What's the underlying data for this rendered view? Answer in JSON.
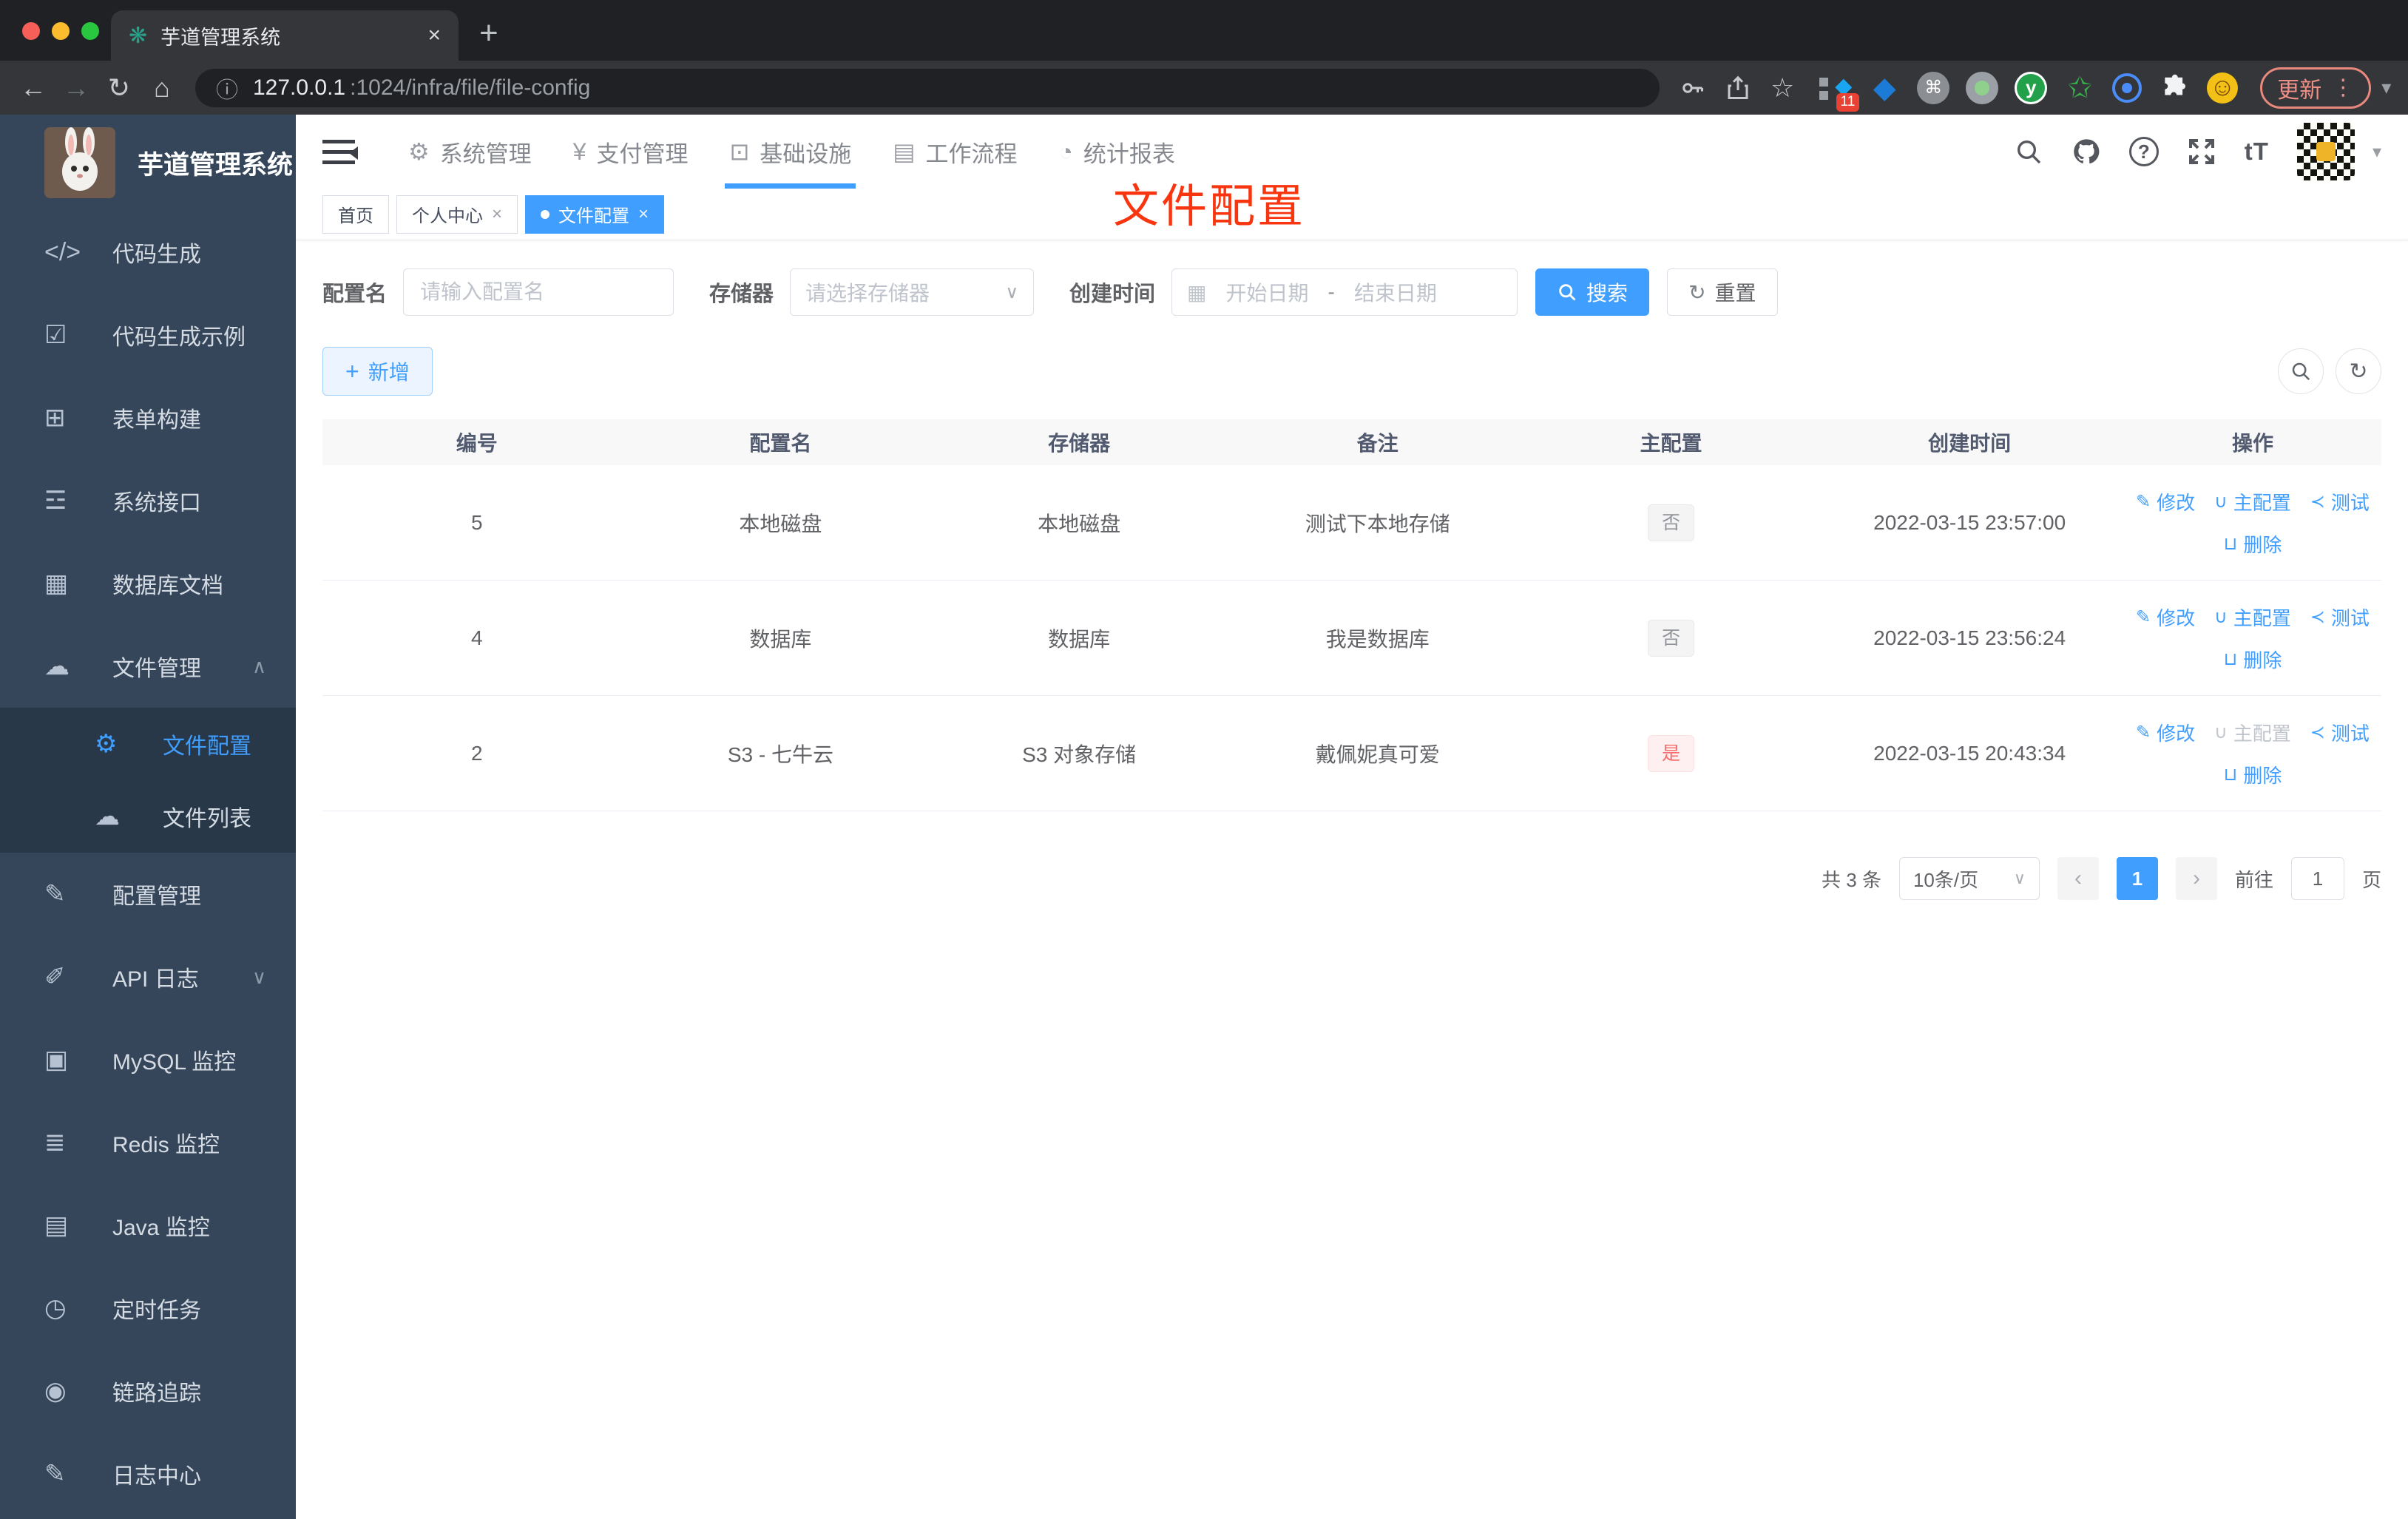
{
  "browser": {
    "tab": {
      "favicon": "❋",
      "title": "芋道管理系统",
      "close": "×",
      "new_tab": "+"
    },
    "nav": {
      "back": "←",
      "forward": "→",
      "reload": "↻",
      "home": "⌂"
    },
    "url": {
      "info": "ⓘ",
      "host": "127.0.0.1",
      "path": ":1024/infra/file/file-config"
    },
    "star": "☆",
    "extensions": {
      "badge": "11",
      "diamond": "◆",
      "kite": "◆",
      "cmd": "⌘",
      "y": "y",
      "star": "✩",
      "smile": "☺"
    },
    "update": {
      "label": "更新",
      "dots": "⋮",
      "caret": "▾"
    }
  },
  "sidebar": {
    "title": "芋道管理系统",
    "items": [
      {
        "icon": "</>",
        "label": "代码生成"
      },
      {
        "icon": "☑",
        "label": "代码生成示例"
      },
      {
        "icon": "⊞",
        "label": "表单构建"
      },
      {
        "icon": "☲",
        "label": "系统接口"
      },
      {
        "icon": "▦",
        "label": "数据库文档"
      },
      {
        "icon": "☁",
        "label": "文件管理",
        "arrow": "∧"
      },
      {
        "icon": "⚙",
        "label": "文件配置"
      },
      {
        "icon": "☁",
        "label": "文件列表"
      },
      {
        "icon": "✎",
        "label": "配置管理"
      },
      {
        "icon": "✐",
        "label": "API 日志",
        "arrow": "∨"
      },
      {
        "icon": "▣",
        "label": "MySQL 监控"
      },
      {
        "icon": "≣",
        "label": "Redis 监控"
      },
      {
        "icon": "▤",
        "label": "Java 监控"
      },
      {
        "icon": "◷",
        "label": "定时任务"
      },
      {
        "icon": "◉",
        "label": "链路追踪"
      },
      {
        "icon": "✎",
        "label": "日志中心"
      }
    ]
  },
  "topnav": {
    "items": [
      {
        "icon": "⚙",
        "label": "系统管理"
      },
      {
        "icon": "¥",
        "label": "支付管理"
      },
      {
        "icon": "⊡",
        "label": "基础设施"
      },
      {
        "icon": "▤",
        "label": "工作流程"
      },
      {
        "icon": "◔",
        "label": "统计报表"
      }
    ],
    "help": "?",
    "font_size": "tT",
    "caret": "▾"
  },
  "tags": {
    "items": [
      {
        "label": "首页"
      },
      {
        "label": "个人中心",
        "close": "×"
      },
      {
        "label": "文件配置",
        "close": "×"
      }
    ]
  },
  "annotation": "文件配置",
  "filter": {
    "name_label": "配置名",
    "name_placeholder": "请输入配置名",
    "storage_label": "存储器",
    "storage_placeholder": "请选择存储器",
    "select_caret": "∨",
    "date_label": "创建时间",
    "calendar": "▦",
    "date_start": "开始日期",
    "date_sep": "-",
    "date_end": "结束日期",
    "search": "搜索",
    "reset": "重置",
    "reset_icon": "↻"
  },
  "toolbar": {
    "add": "新增",
    "plus": "+",
    "refresh_icon": "↻"
  },
  "table": {
    "headers": [
      "编号",
      "配置名",
      "存储器",
      "备注",
      "主配置",
      "创建时间",
      "操作"
    ],
    "rows": [
      {
        "id": "5",
        "name": "本地磁盘",
        "storage": "本地磁盘",
        "remark": "测试下本地存储",
        "master": "否",
        "created": "2022-03-15 23:57:00"
      },
      {
        "id": "4",
        "name": "数据库",
        "storage": "数据库",
        "remark": "我是数据库",
        "master": "否",
        "created": "2022-03-15 23:56:24"
      },
      {
        "id": "2",
        "name": "S3 - 七牛云",
        "storage": "S3 对象存储",
        "remark": "戴佩妮真可爱",
        "master": "是",
        "created": "2022-03-15 20:43:34"
      }
    ],
    "actions": {
      "edit": "修改",
      "master": "主配置",
      "test": "测试",
      "del": "删除"
    },
    "icons": {
      "edit": "✎",
      "master": "∪",
      "test": "≺",
      "del": "⊔"
    }
  },
  "pagination": {
    "total": "共 3 条",
    "size": "10条/页",
    "caret": "∨",
    "prev": "‹",
    "page": "1",
    "next": "›",
    "goto": "前往",
    "value": "1",
    "unit": "页"
  }
}
